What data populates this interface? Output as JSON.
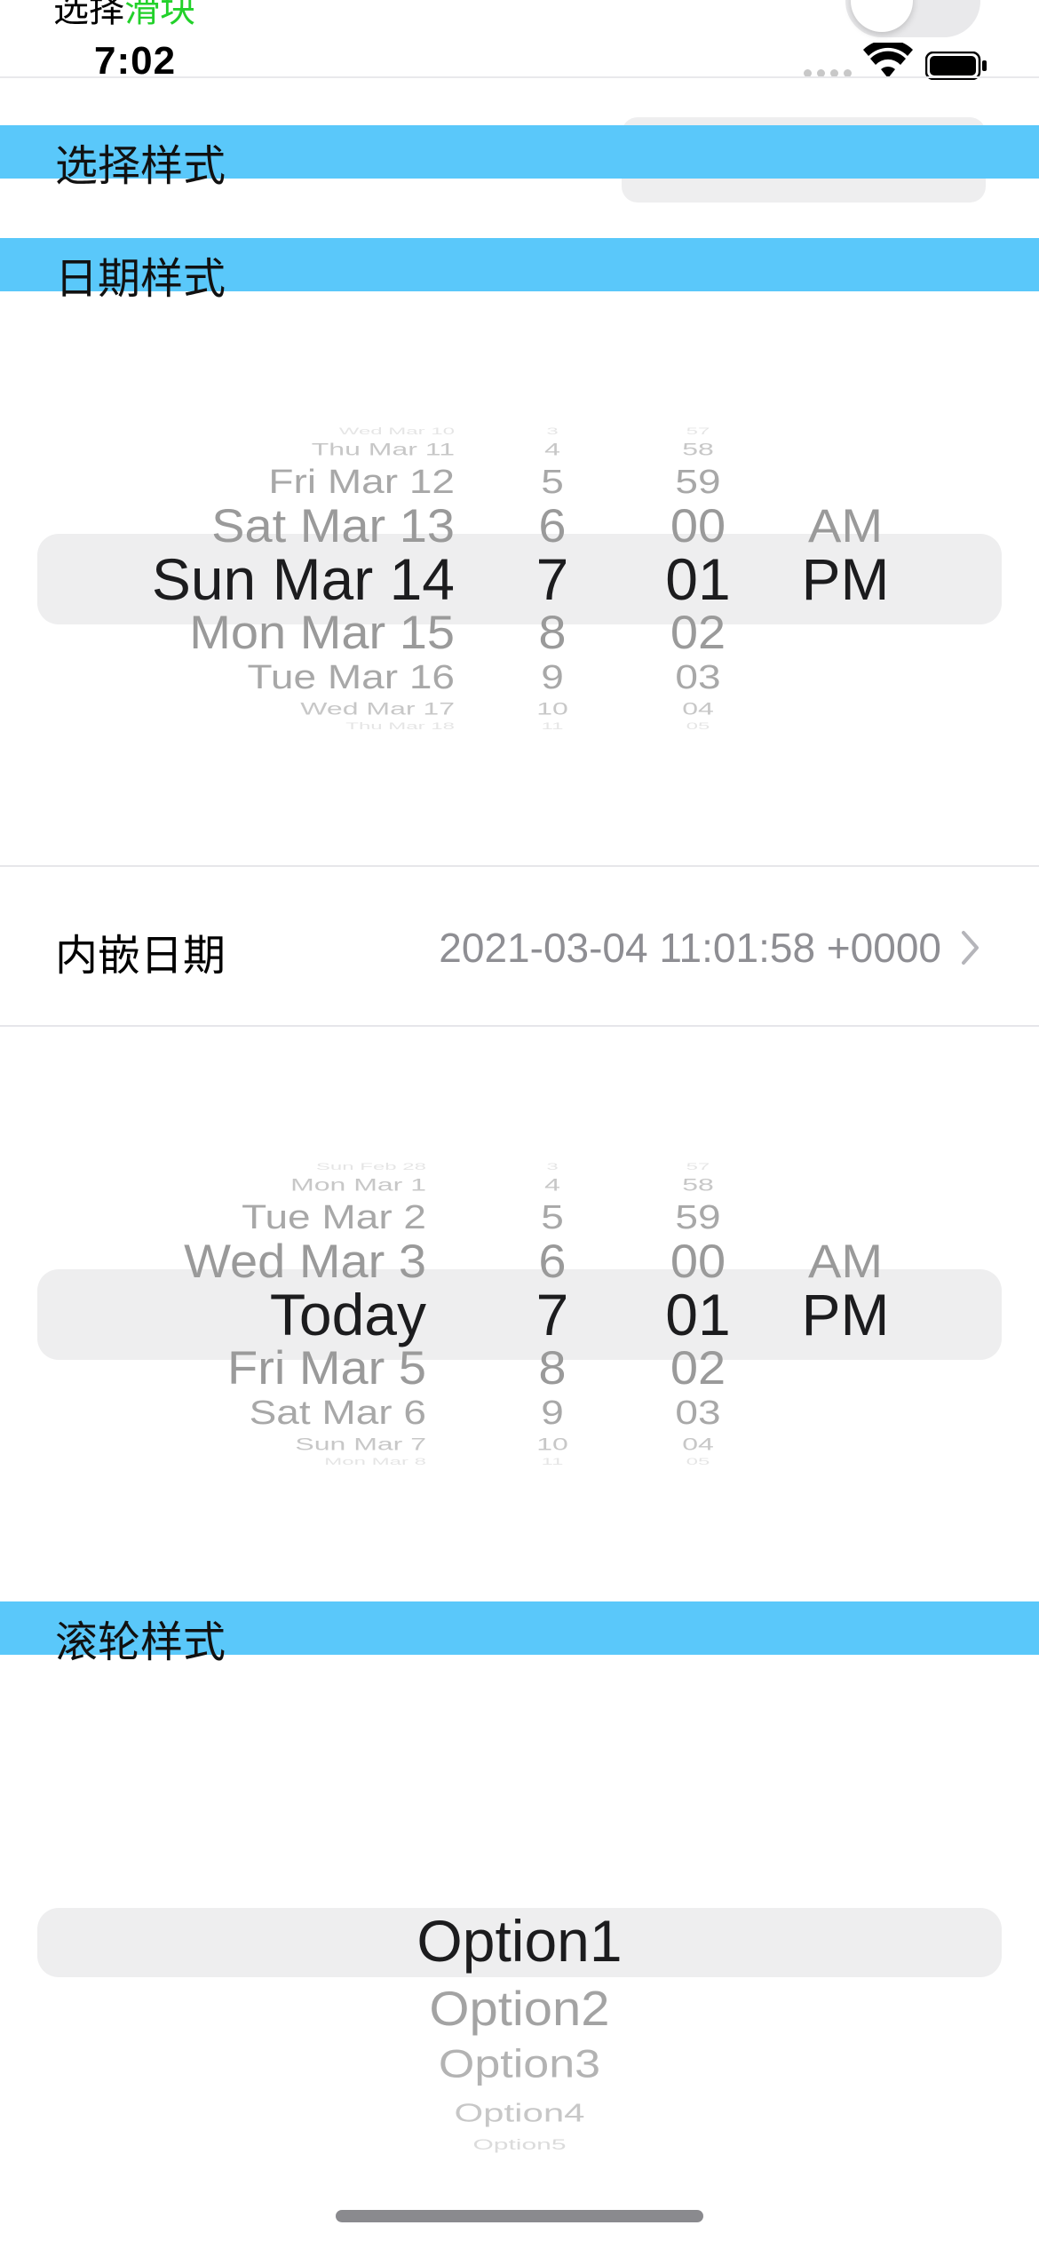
{
  "top_row": {
    "label": "选择",
    "label_green": "滑块"
  },
  "status_bar": {
    "time": "7:02"
  },
  "sections": {
    "selection_style": "选择样式",
    "date_style": "日期样式",
    "wheel_style": "滚轮样式"
  },
  "picker1": {
    "rows": [
      {
        "date": "Wed Mar 10",
        "hour": "3",
        "minute": "57",
        "ampm": ""
      },
      {
        "date": "Thu Mar 11",
        "hour": "4",
        "minute": "58",
        "ampm": ""
      },
      {
        "date": "Fri Mar 12",
        "hour": "5",
        "minute": "59",
        "ampm": ""
      },
      {
        "date": "Sat Mar 13",
        "hour": "6",
        "minute": "00",
        "ampm": "AM"
      },
      {
        "date": "Sun Mar 14",
        "hour": "7",
        "minute": "01",
        "ampm": "PM"
      },
      {
        "date": "Mon Mar 15",
        "hour": "8",
        "minute": "02",
        "ampm": ""
      },
      {
        "date": "Tue Mar 16",
        "hour": "9",
        "minute": "03",
        "ampm": ""
      },
      {
        "date": "Wed Mar 17",
        "hour": "10",
        "minute": "04",
        "ampm": ""
      },
      {
        "date": "Thu Mar 18",
        "hour": "11",
        "minute": "05",
        "ampm": ""
      }
    ]
  },
  "inline_date_row": {
    "label": "内嵌日期",
    "value": "2021-03-04 11:01:58 +0000"
  },
  "picker2": {
    "rows": [
      {
        "date": "Sun Feb 28",
        "hour": "3",
        "minute": "57",
        "ampm": ""
      },
      {
        "date": "Mon Mar 1",
        "hour": "4",
        "minute": "58",
        "ampm": ""
      },
      {
        "date": "Tue Mar 2",
        "hour": "5",
        "minute": "59",
        "ampm": ""
      },
      {
        "date": "Wed Mar 3",
        "hour": "6",
        "minute": "00",
        "ampm": "AM"
      },
      {
        "date": "Today",
        "hour": "7",
        "minute": "01",
        "ampm": "PM"
      },
      {
        "date": "Fri Mar 5",
        "hour": "8",
        "minute": "02",
        "ampm": ""
      },
      {
        "date": "Sat Mar 6",
        "hour": "9",
        "minute": "03",
        "ampm": ""
      },
      {
        "date": "Sun Mar 7",
        "hour": "10",
        "minute": "04",
        "ampm": ""
      },
      {
        "date": "Mon Mar 8",
        "hour": "11",
        "minute": "05",
        "ampm": ""
      }
    ]
  },
  "wheel": {
    "options": [
      "Option1",
      "Option2",
      "Option3",
      "Option4",
      "Option5"
    ]
  },
  "colors": {
    "section_header": "#5ac8fa",
    "selection_band": "#eeeeef",
    "slider_green": "#22d12a"
  }
}
